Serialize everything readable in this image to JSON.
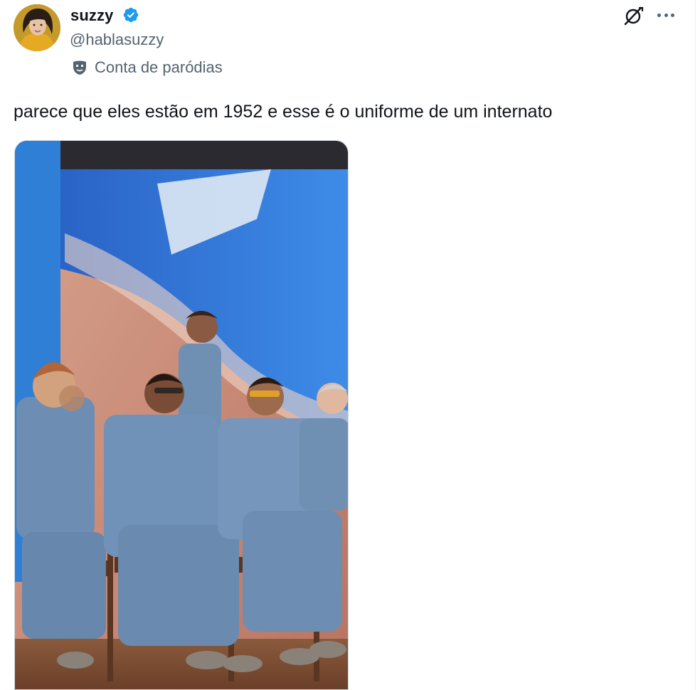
{
  "user": {
    "display_name": "suzzy",
    "handle": "@hablasuzzy",
    "parody_label": "Conta de paródias",
    "verified_icon": "verified-badge-icon",
    "avatar_icon": "avatar"
  },
  "toolbar": {
    "grok_icon": "grok-icon",
    "more_icon": "more-icon"
  },
  "tweet": {
    "text": "parece que eles estão em 1952 e esse é o uniforme de um internato"
  },
  "colors": {
    "verified": "#1d9bf0",
    "secondary_text": "#536471",
    "primary_text": "#0f1419",
    "suit_blue": "#6f8fb3",
    "screen_blue": "#2f6fd1"
  }
}
